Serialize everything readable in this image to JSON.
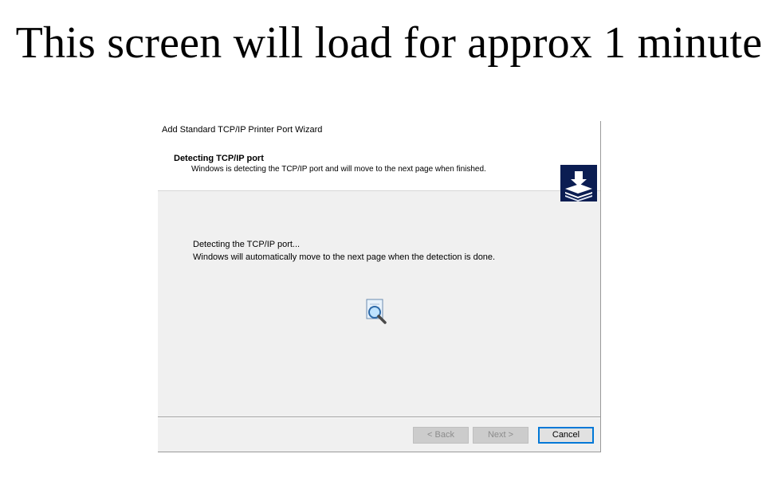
{
  "slide": {
    "title": "This screen will load for approx 1 minute"
  },
  "dialog": {
    "window_title": "Add Standard TCP/IP Printer Port Wizard",
    "header": {
      "title": "Detecting TCP/IP port",
      "subtitle": "Windows is detecting the TCP/IP port and will move to the next page when finished.",
      "icon": "printer-wizard-icon"
    },
    "body": {
      "line1": "Detecting the TCP/IP port...",
      "line2": "Windows will automatically move to the next page when the detection is done.",
      "animation_icon": "search-animation-icon"
    },
    "buttons": {
      "back": "< Back",
      "next": "Next >",
      "cancel": "Cancel"
    },
    "colors": {
      "accent": "#0078d7",
      "icon_bg": "#0b1d52"
    }
  }
}
